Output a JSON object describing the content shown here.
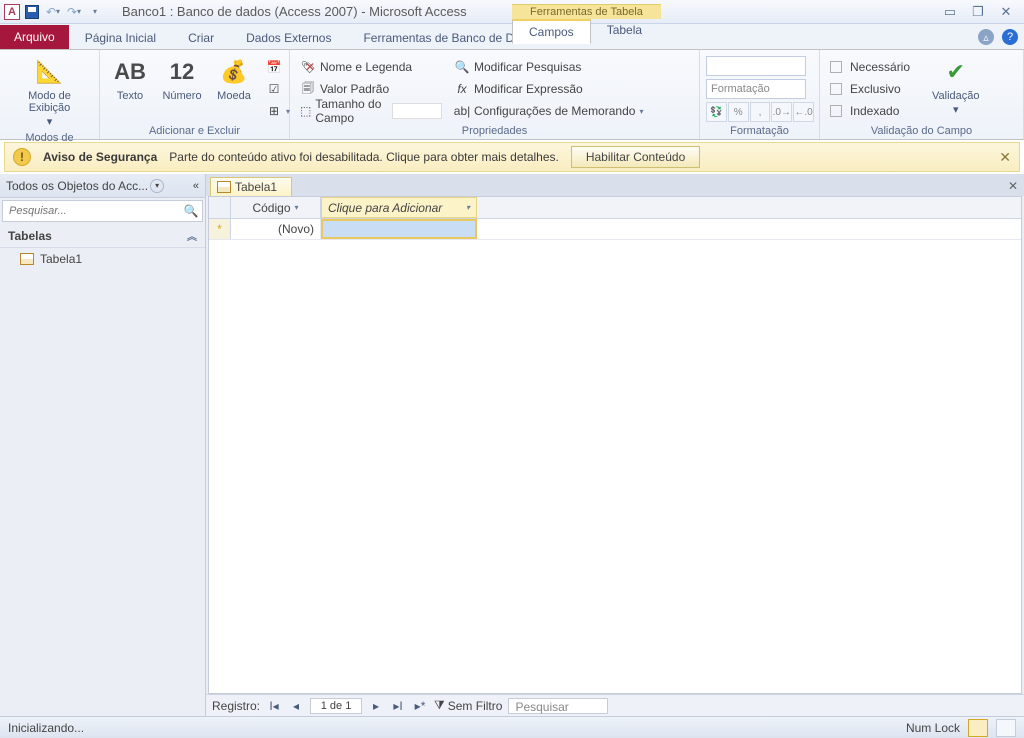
{
  "titlebar": {
    "title": "Banco1 : Banco de dados (Access 2007)  -  Microsoft Access",
    "context_title": "Ferramentas de Tabela"
  },
  "tabs": {
    "file": "Arquivo",
    "home": "Página Inicial",
    "create": "Criar",
    "external": "Dados Externos",
    "dbtools": "Ferramentas de Banco de Dados",
    "ctx_fields": "Campos",
    "ctx_table": "Tabela"
  },
  "ribbon": {
    "views_group": "Modos de Exibição",
    "view_btn": "Modo de\nExibição",
    "addremove_group": "Adicionar e Excluir",
    "text_btn": "Texto",
    "number_btn": "Número",
    "currency_btn": "Moeda",
    "props_group": "Propriedades",
    "name_caption": "Nome e Legenda",
    "default_val": "Valor Padrão",
    "field_size": "Tamanho do Campo",
    "mod_lookups": "Modificar Pesquisas",
    "mod_expr": "Modificar Expressão",
    "memo_settings": "Configurações de Memorando",
    "formatting_group": "Formatação",
    "format_combo": "Formatação",
    "validation_group": "Validação do Campo",
    "required": "Necessário",
    "unique": "Exclusivo",
    "indexed": "Indexado",
    "validation_btn": "Validação"
  },
  "msgbar": {
    "title": "Aviso de Segurança",
    "text": "Parte do conteúdo ativo foi desabilitada. Clique para obter mais detalhes.",
    "enable": "Habilitar Conteúdo"
  },
  "nav": {
    "header": "Todos os Objetos do Acc...",
    "search_ph": "Pesquisar...",
    "section": "Tabelas",
    "item1": "Tabela1"
  },
  "doc": {
    "tab": "Tabela1",
    "col_id": "Código",
    "col_add": "Clique para Adicionar",
    "new_row": "(Novo)"
  },
  "recnav": {
    "label": "Registro:",
    "pos": "1 de 1",
    "nofilter": "Sem Filtro",
    "search": "Pesquisar"
  },
  "status": {
    "left": "Inicializando...",
    "numlock": "Num Lock"
  }
}
